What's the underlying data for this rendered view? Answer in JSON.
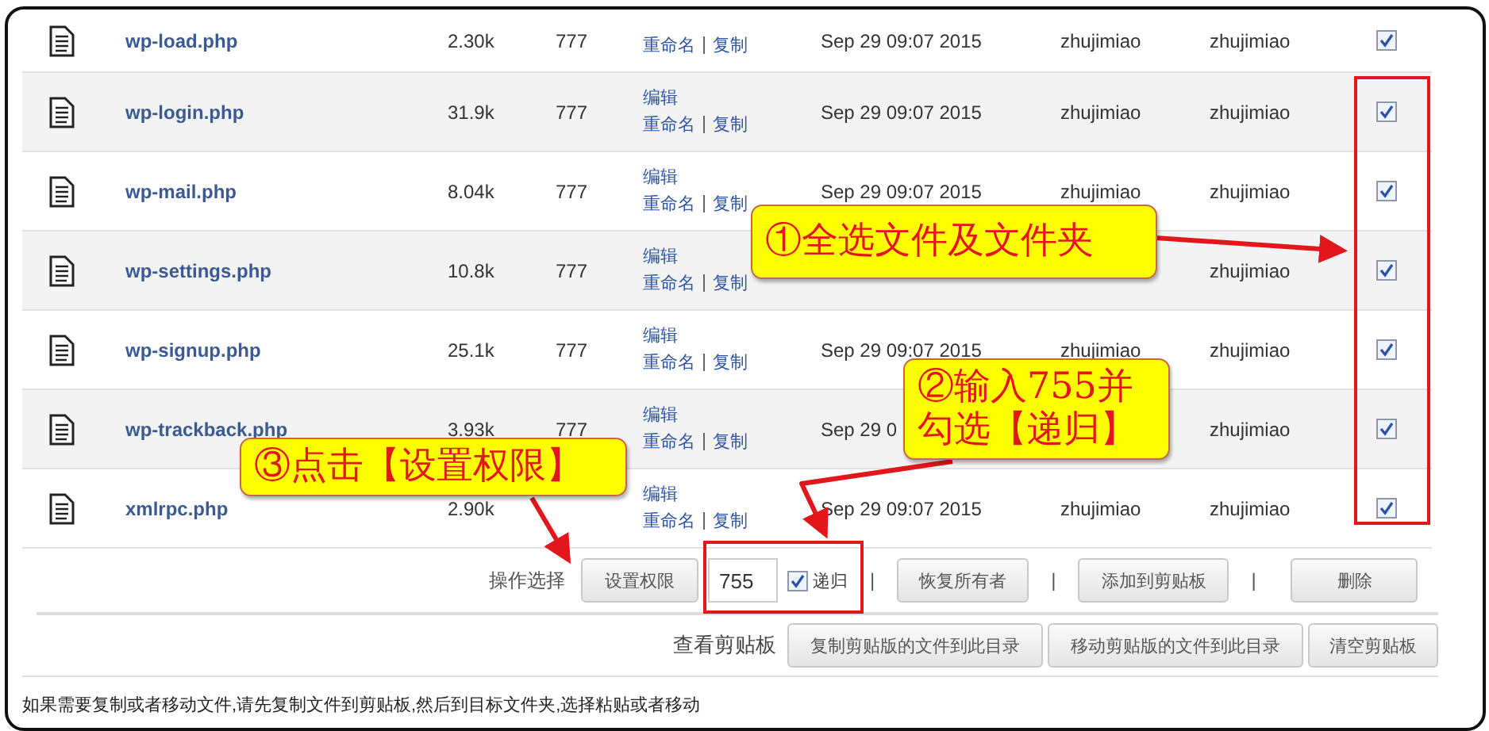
{
  "files": [
    {
      "name": "wp-load.php",
      "size": "2.30k",
      "permission": "777",
      "rename": "重命名",
      "copy": "复制",
      "date": "Sep 29 09:07 2015",
      "owner": "zhujimiao",
      "group": "zhujimiao",
      "checked": true
    },
    {
      "name": "wp-login.php",
      "size": "31.9k",
      "permission": "777",
      "edit": "编辑",
      "rename": "重命名",
      "copy": "复制",
      "date": "Sep 29 09:07 2015",
      "owner": "zhujimiao",
      "group": "zhujimiao",
      "checked": true
    },
    {
      "name": "wp-mail.php",
      "size": "8.04k",
      "permission": "777",
      "edit": "编辑",
      "rename": "重命名",
      "copy": "复制",
      "date": "Sep 29 09:07 2015",
      "owner": "zhujimiao",
      "group": "zhujimiao",
      "checked": true
    },
    {
      "name": "wp-settings.php",
      "size": "10.8k",
      "permission": "777",
      "edit": "编辑",
      "rename": "重命名",
      "copy": "复制",
      "group": "zhujimiao",
      "checked": true
    },
    {
      "name": "wp-signup.php",
      "size": "25.1k",
      "permission": "777",
      "edit": "编辑",
      "rename": "重命名",
      "copy": "复制",
      "date": "Sep 29 09:07 2015",
      "owner": "zhujimiao",
      "group": "zhujimiao",
      "checked": true
    },
    {
      "name": "wp-trackback.php",
      "size": "3.93k",
      "permission": "777",
      "edit": "编辑",
      "rename": "重命名",
      "copy": "复制",
      "date": "Sep 29 0",
      "group": "zhujimiao",
      "checked": true
    },
    {
      "name": "xmlrpc.php",
      "size": "2.90k",
      "edit": "编辑",
      "rename": "重命名",
      "copy": "复制",
      "date": "Sep 29 09:07 2015",
      "owner": "zhujimiao",
      "group": "zhujimiao",
      "checked": true
    }
  ],
  "operations": {
    "label": "操作选择",
    "set_permission": "设置权限",
    "mode_value": "755",
    "recursive": {
      "label": "递归",
      "checked": true
    },
    "separators": [
      "|",
      "|",
      "|"
    ],
    "buttons": [
      "恢复所有者",
      "添加到剪贴板",
      "删除"
    ]
  },
  "clipboard": {
    "label": "查看剪贴板",
    "buttons": [
      "复制剪贴版的文件到此目录",
      "移动剪贴版的文件到此目录",
      "清空剪贴板"
    ]
  },
  "footer_note": "如果需要复制或者移动文件,请先复制文件到剪贴板,然后到目标文件夹,选择粘贴或者移动",
  "annotations": [
    {
      "lines": [
        "①全选文件及文件夹"
      ]
    },
    {
      "lines": [
        "②输入755并",
        "勾选【递归】"
      ]
    },
    {
      "lines": [
        "③点击【设置权限】"
      ]
    }
  ]
}
